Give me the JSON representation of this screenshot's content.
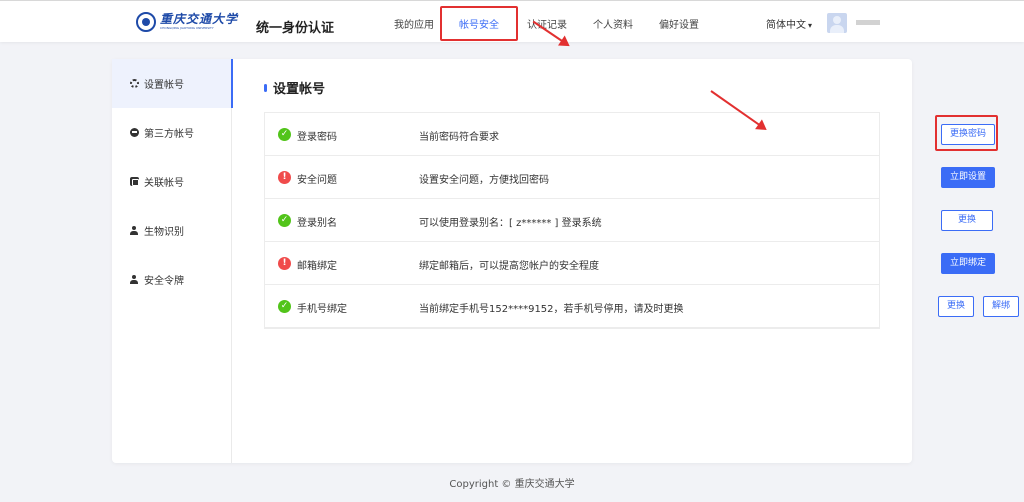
{
  "header": {
    "logo": {
      "cn": "重庆交通大学",
      "en": "CHONGQING JIAOTONG UNIVERSITY"
    },
    "app_title": "统一身份认证",
    "nav": [
      {
        "label": "我的应用"
      },
      {
        "label": "帐号安全",
        "active": true
      },
      {
        "label": "认证记录"
      },
      {
        "label": "个人资料"
      },
      {
        "label": "偏好设置"
      }
    ],
    "language": "简体中文",
    "chevron": "chevron-down-icon"
  },
  "sidebar": {
    "items": [
      {
        "label": "设置帐号",
        "icon": "gear-icon",
        "active": true
      },
      {
        "label": "第三方帐号",
        "icon": "third-party-icon"
      },
      {
        "label": "关联帐号",
        "icon": "link-account-icon"
      },
      {
        "label": "生物识别",
        "icon": "person-icon"
      },
      {
        "label": "安全令牌",
        "icon": "person-icon"
      }
    ]
  },
  "main": {
    "title": "设置帐号",
    "rows": [
      {
        "status": "ok",
        "label": "登录密码",
        "desc": "当前密码符合要求",
        "buttons": [
          {
            "label": "更换密码",
            "style": "outline"
          }
        ]
      },
      {
        "status": "warn",
        "label": "安全问题",
        "desc": "设置安全问题，方便找回密码",
        "buttons": [
          {
            "label": "立即设置",
            "style": "solid"
          }
        ]
      },
      {
        "status": "ok",
        "label": "登录别名",
        "desc": "可以使用登录别名：[ z****** ] 登录系统",
        "buttons": [
          {
            "label": "更换",
            "style": "outline"
          }
        ]
      },
      {
        "status": "warn",
        "label": "邮箱绑定",
        "desc": "绑定邮箱后，可以提高您帐户的安全程度",
        "buttons": [
          {
            "label": "立即绑定",
            "style": "solid"
          }
        ]
      },
      {
        "status": "ok",
        "label": "手机号绑定",
        "desc": "当前绑定手机号152****9152，若手机号停用，请及时更换",
        "buttons": [
          {
            "label": "更换",
            "style": "outline"
          },
          {
            "label": "解绑",
            "style": "outline"
          }
        ]
      }
    ]
  },
  "footer": {
    "copyright": "Copyright © 重庆交通大学"
  },
  "colors": {
    "accent": "#3b6cf6",
    "ok": "#52c41a",
    "warn": "#f04b4b",
    "highlight": "#e23030"
  }
}
